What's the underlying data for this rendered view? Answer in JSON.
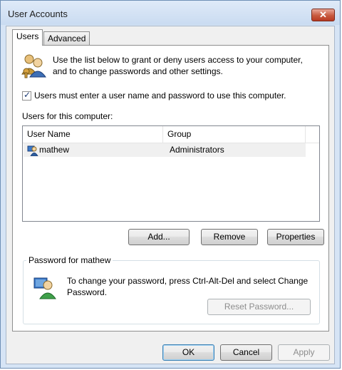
{
  "window": {
    "title": "User Accounts",
    "close_label": "✕"
  },
  "tabs": [
    {
      "label": "Users",
      "selected": true
    },
    {
      "label": "Advanced",
      "selected": false
    }
  ],
  "users_tab": {
    "intro_text": "Use the list below to grant or deny users access to your computer, and to change passwords and other settings.",
    "require_login": {
      "label": "Users must enter a user name and password to use this computer.",
      "checked": true
    },
    "list_caption": "Users for this computer:",
    "columns": [
      "User Name",
      "Group"
    ],
    "rows": [
      {
        "user_name": "mathew",
        "group": "Administrators",
        "selected": true
      }
    ],
    "buttons": {
      "add": "Add...",
      "remove": "Remove",
      "properties": "Properties"
    },
    "password_group": {
      "title": "Password for mathew",
      "text": "To change your password, press Ctrl-Alt-Del and select Change Password.",
      "reset_button": "Reset Password..."
    }
  },
  "dialog_buttons": {
    "ok": "OK",
    "cancel": "Cancel",
    "apply": "Apply"
  },
  "icons": {
    "users": "users-icon",
    "user": "user-icon",
    "password": "password-user-icon",
    "close": "close-icon"
  }
}
